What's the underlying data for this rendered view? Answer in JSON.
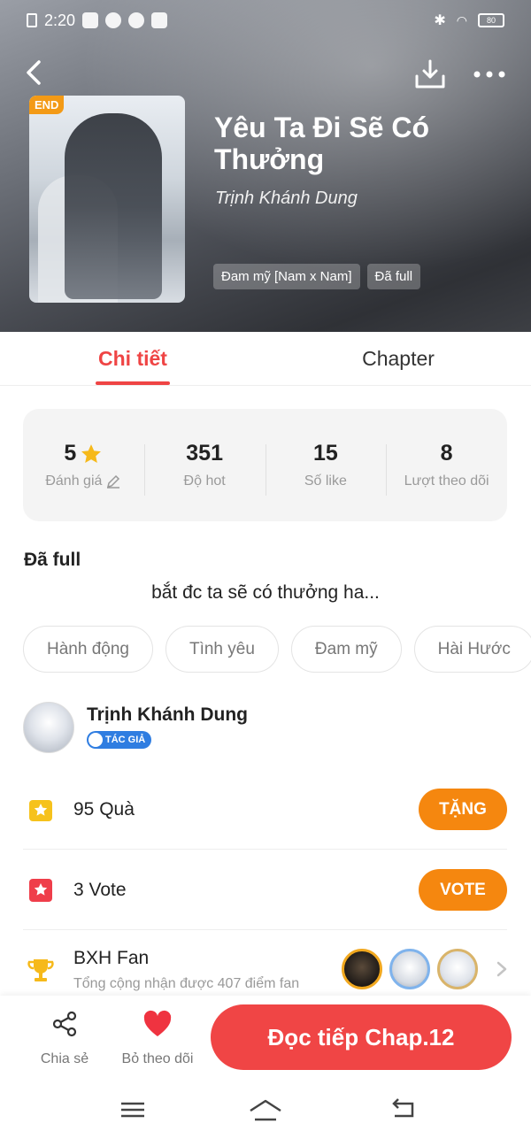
{
  "status_bar": {
    "time": "2:20",
    "battery": "80"
  },
  "book": {
    "title": "Yêu Ta Đi Sẽ Có Thưởng",
    "author": "Trịnh Khánh Dung",
    "end_badge": "END",
    "tags": [
      "Đam mỹ [Nam x Nam]",
      "Đã full"
    ]
  },
  "tabs": [
    {
      "label": "Chi tiết",
      "active": true
    },
    {
      "label": "Chapter",
      "active": false
    }
  ],
  "stats": [
    {
      "value": "5",
      "label": "Đánh giá"
    },
    {
      "value": "351",
      "label": "Độ hot"
    },
    {
      "value": "15",
      "label": "Số like"
    },
    {
      "value": "8",
      "label": "Lượt theo dõi"
    }
  ],
  "status_label": "Đã full",
  "description": "bắt đc ta sẽ có thưởng ha...",
  "genres": [
    "Hành động",
    "Tình yêu",
    "Đam mỹ",
    "Hài Hước"
  ],
  "author_card": {
    "name": "Trịnh Khánh Dung",
    "badge": "TÁC GIẢ"
  },
  "gifts": {
    "text": "95  Quà",
    "button": "TẶNG"
  },
  "votes": {
    "text": "3  Vote",
    "button": "VOTE"
  },
  "fans": {
    "title": "BXH Fan",
    "subtitle": "Tổng cộng nhận được 407 điểm fan"
  },
  "bottom": {
    "share_label": "Chia sẻ",
    "unfollow_label": "Bỏ theo dõi",
    "read_button": "Đọc tiếp Chap.12"
  },
  "colors": {
    "accent": "#ef4444",
    "orange": "#f5870f",
    "badge_blue": "#2f7de1"
  }
}
